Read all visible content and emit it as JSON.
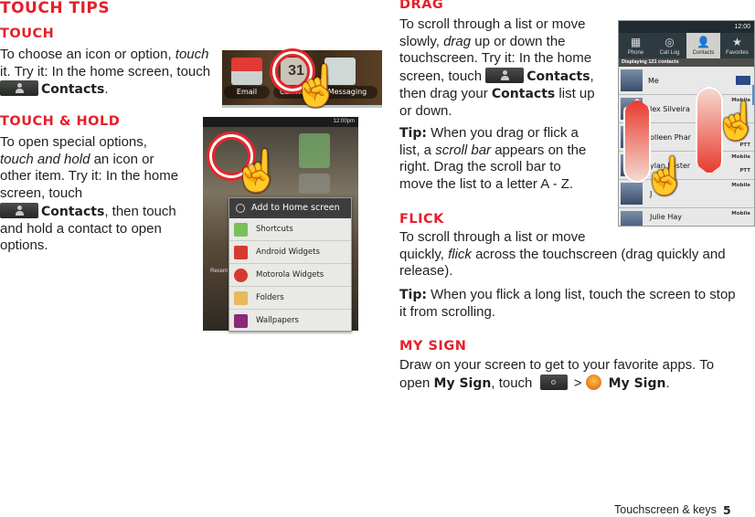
{
  "page_title": "Touch tips",
  "touch": {
    "heading": "Touch",
    "l1a": "To choose an icon or option, ",
    "l1b": "touch",
    "l2": "it. Try it: In the home screen, touch",
    "l3b": "Contacts",
    "l3c": "."
  },
  "hold": {
    "heading": "Touch & hold",
    "l1": "To open special options,",
    "l2a": "touch and hold",
    "l2b": " an icon or",
    "l3": "other item. Try it: In the home",
    "l4": "screen, touch",
    "l5b": "Contacts",
    "l5c": ", then touch",
    "l6": "and hold a contact to open",
    "l7": "options."
  },
  "drag": {
    "heading": "Drag",
    "l1": "To scroll through a list or move",
    "l2a": "slowly, ",
    "l2b": "drag",
    "l2c": " up or down the",
    "l3": "touchscreen. Try it: In the home",
    "l4a": "screen, touch ",
    "l4b": "Contacts",
    "l4c": ",",
    "l5a": "then drag your ",
    "l5b": "Contacts",
    "l5c": " list up",
    "l6": "or down.",
    "tip_label": "Tip:",
    "t1": " When you drag or flick a",
    "t2a": "list, a ",
    "t2b": "scroll bar",
    "t2c": " appears on the",
    "t3": "right. Drag the scroll bar to",
    "t4": "move the list to a letter A - Z."
  },
  "flick": {
    "heading": "Flick",
    "l1": "To scroll through a list or move",
    "l2a": "quickly, ",
    "l2b": "flick",
    "l2c": " across the touchscreen (drag quickly and",
    "l3": "release).",
    "tip_label": "Tip:",
    "t1": " When you flick a long list, touch the screen to stop",
    "t2": "it from scrolling."
  },
  "mysign": {
    "heading": "My Sign",
    "l1": "Draw on your screen to get to your favorite apps. To",
    "l2a": "open ",
    "l2b": "My Sign",
    "l2c": ", touch ",
    "sep": ">",
    "l2d": "My Sign",
    "l2e": "."
  },
  "fig_home_apps": {
    "email": "Email",
    "calendar": "Calendar",
    "calendar_day": "31",
    "messaging": "Messaging"
  },
  "fig_add_home": {
    "time": "12:00pm",
    "recent": "Recent",
    "title": "Add to Home screen",
    "items": [
      "Shortcuts",
      "Android Widgets",
      "Motorola Widgets",
      "Folders",
      "Wallpapers"
    ]
  },
  "fig_contacts": {
    "time": "12:00",
    "tabs": [
      "Phone",
      "Call Log",
      "Contacts",
      "Favorites"
    ],
    "selected_tab": "Contacts",
    "count": "Displaying 121 contacts",
    "rows": [
      {
        "name": "Me",
        "types": []
      },
      {
        "name": "lex Silveira",
        "types": [
          "Mobile"
        ]
      },
      {
        "name": "olleen Phar",
        "types": [
          "PTT"
        ]
      },
      {
        "name": "ylan Foster",
        "types": [
          "Mobile",
          "PTT"
        ]
      },
      {
        "name": "J",
        "types": [
          "Mobile"
        ]
      },
      {
        "name": "Julie Hay",
        "types": [
          "Mobile"
        ]
      }
    ]
  },
  "footer": {
    "section": "Touchscreen & keys",
    "page": "5"
  },
  "colors": {
    "heading": "#e5202a",
    "text": "#231f20"
  }
}
